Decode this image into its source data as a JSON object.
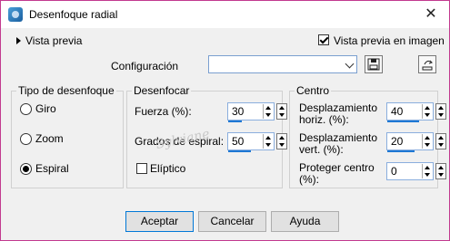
{
  "window": {
    "title": "Desenfoque radial"
  },
  "preview": {
    "label": "Vista previa",
    "image_preview_label": "Vista previa en imagen",
    "image_preview_checked": true
  },
  "config": {
    "label": "Configuración",
    "value": ""
  },
  "blur_type": {
    "title": "Tipo de desenfoque",
    "options": [
      {
        "label": "Giro",
        "checked": false
      },
      {
        "label": "Zoom",
        "checked": false
      },
      {
        "label": "Espiral",
        "checked": true
      }
    ]
  },
  "desenfocar": {
    "title": "Desenfocar",
    "fuerza_label": "Fuerza (%):",
    "fuerza_value": "30",
    "grados_label": "Grados de espiral:",
    "grados_value": "50",
    "eliptico_label": "Elíptico",
    "eliptico_checked": false
  },
  "centro": {
    "title": "Centro",
    "horiz_label_1": "Desplazamiento",
    "horiz_label_2": "horiz. (%):",
    "horiz_value": "40",
    "vert_label_1": "Desplazamiento",
    "vert_label_2": "vert. (%):",
    "vert_value": "20",
    "protect_label_1": "Proteger centro",
    "protect_label_2": "(%):",
    "protect_value": "0"
  },
  "buttons": {
    "accept": "Aceptar",
    "cancel": "Cancelar",
    "help": "Ayuda"
  },
  "watermark": "Sylviane"
}
